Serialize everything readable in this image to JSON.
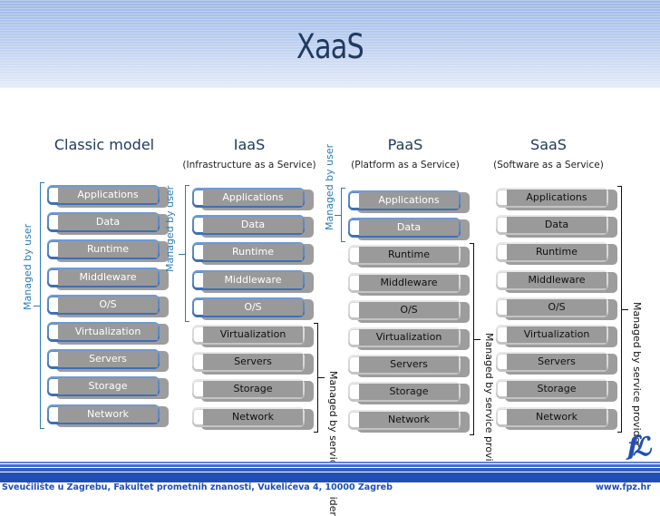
{
  "header": {
    "title": "XaaS"
  },
  "layers": [
    "Applications",
    "Data",
    "Runtime",
    "Middleware",
    "O/S",
    "Virtualization",
    "Servers",
    "Storage",
    "Network"
  ],
  "columns": [
    {
      "id": "classic",
      "title": "Classic model",
      "subtitle": "",
      "user_managed_count": 9,
      "labels": {
        "user": "Managed by user",
        "provider": ""
      }
    },
    {
      "id": "iaas",
      "title": "IaaS",
      "subtitle": "(Infrastructure as a Service)",
      "user_managed_count": 5,
      "labels": {
        "user": "Managed by user",
        "provider": "Managed by service provider"
      }
    },
    {
      "id": "paas",
      "title": "PaaS",
      "subtitle": "(Platform as a Service)",
      "user_managed_count": 2,
      "labels": {
        "user": "Managed by user",
        "provider": "Managed by service provider"
      }
    },
    {
      "id": "saas",
      "title": "SaaS",
      "subtitle": "(Software as a Service)",
      "user_managed_count": 0,
      "labels": {
        "user": "",
        "provider": "Managed by service provider"
      }
    }
  ],
  "footer": {
    "left": "Sveučilište u Zagrebu, Fakultet prometnih znanosti, Vukelićeva 4, 10000 Zagreb",
    "right": "www.fpz.hr",
    "logo": "fℒ"
  },
  "colors": {
    "user_blue": "#5b88c8",
    "label_blue": "#2b7bb9",
    "title_navy": "#1f3a60",
    "footer_blue": "#1f4fb4"
  }
}
